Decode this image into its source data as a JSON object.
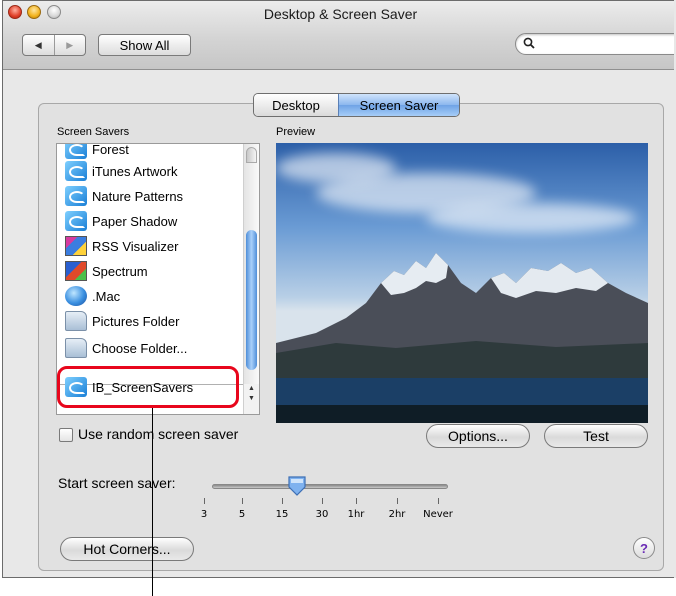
{
  "window": {
    "title": "Desktop & Screen Saver"
  },
  "toolbar": {
    "back_icon": "back-arrow-icon",
    "forward_icon": "forward-arrow-icon",
    "show_all_label": "Show All",
    "search_placeholder": ""
  },
  "tabs": [
    {
      "label": "Desktop",
      "selected": false
    },
    {
      "label": "Screen Saver",
      "selected": true
    }
  ],
  "screen_savers": {
    "label": "Screen Savers",
    "items": [
      {
        "label": "Forest",
        "icon": "screensaver-icon"
      },
      {
        "label": "iTunes Artwork",
        "icon": "screensaver-icon"
      },
      {
        "label": "Nature Patterns",
        "icon": "screensaver-icon"
      },
      {
        "label": "Paper Shadow",
        "icon": "screensaver-icon"
      },
      {
        "label": "RSS Visualizer",
        "icon": "rss-visualizer-icon"
      },
      {
        "label": "Spectrum",
        "icon": "spectrum-icon"
      },
      {
        "label": ".Mac",
        "icon": "dotmac-icon"
      },
      {
        "label": "Pictures Folder",
        "icon": "pictures-folder-icon"
      },
      {
        "label": "Choose Folder...",
        "icon": "folder-icon"
      }
    ],
    "selected": {
      "label": "IB_ScreenSavers",
      "icon": "screensaver-icon"
    }
  },
  "preview": {
    "label": "Preview"
  },
  "random": {
    "label": "Use random screen saver",
    "checked": false
  },
  "buttons": {
    "options": "Options...",
    "test": "Test",
    "hot_corners": "Hot Corners...",
    "help": "?"
  },
  "start": {
    "label": "Start screen saver:",
    "ticks": [
      "3",
      "5",
      "15",
      "30",
      "1hr",
      "2hr",
      "Never"
    ],
    "selected_value": "15"
  },
  "colors": {
    "accent": "#6fa3e6",
    "highlight": "#e8061c"
  }
}
